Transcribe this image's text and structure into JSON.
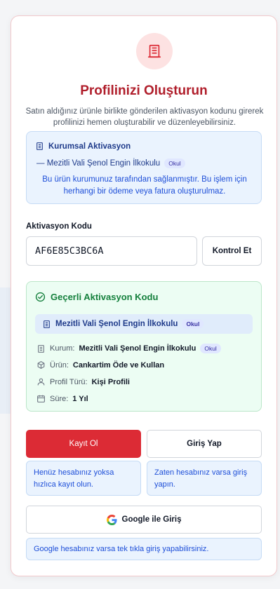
{
  "header": {
    "title": "Profilinizi Oluşturun",
    "subtitle": "Satın aldığınız ürünle birlikte gönderilen aktivasyon kodunu girerek profilinizi hemen oluşturabilir ve düzenleyebilirsiniz."
  },
  "institution_box": {
    "heading": "Kurumsal Aktivasyon",
    "school": "— Mezitli Vali Şenol Engin İlkokulu",
    "badge": "Okul",
    "note": "Bu ürün kurumunuz tarafından sağlanmıştır. Bu işlem için herhangi bir ödeme veya fatura oluşturulmaz."
  },
  "activation": {
    "label": "Aktivasyon Kodu",
    "code": "AF6E85C3BC6A",
    "check_button": "Kontrol Et"
  },
  "valid_box": {
    "heading": "Geçerli Aktivasyon Kodu",
    "institution": "Mezitli Vali Şenol Engin İlkokulu",
    "institution_badge": "Okul",
    "rows": [
      {
        "label": "Kurum:",
        "value": "Mezitli Vali Şenol Engin İlkokulu",
        "badge": "Okul"
      },
      {
        "label": "Ürün:",
        "value": "Cankartim Öde ve Kullan"
      },
      {
        "label": "Profil Türü:",
        "value": "Kişi Profili"
      },
      {
        "label": "Süre:",
        "value": "1 Yıl"
      }
    ]
  },
  "actions": {
    "register": "Kayıt Ol",
    "login": "Giriş Yap",
    "register_hint": "Henüz hesabınız yoksa hızlıca kayıt olun.",
    "login_hint": "Zaten hesabınız varsa giriş yapın.",
    "google": "Google ile Giriş",
    "google_hint": "Google hesabınız varsa tek tıkla giriş yapabilirsiniz."
  },
  "colors": {
    "primary": "#dc2b35",
    "title": "#b01e2b",
    "success": "#15803d",
    "info": "#1d4ed8"
  },
  "icons": {
    "logo": "building-icon",
    "kurumsal": "building-icon",
    "valid": "check-circle-icon",
    "kurum": "building-icon",
    "urun": "box-icon",
    "profil": "user-icon",
    "sure": "calendar-icon",
    "google": "google-icon"
  }
}
